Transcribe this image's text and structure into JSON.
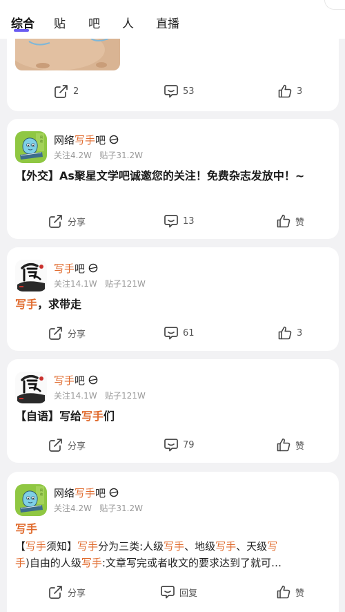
{
  "tabs": [
    "综合",
    "贴",
    "吧",
    "人",
    "直播"
  ],
  "posts": [
    {
      "counts": {
        "edit": "2",
        "comment": "53",
        "like": "3"
      }
    },
    {
      "forum_prefix": "网络",
      "forum_kw": "写手",
      "forum_suffix": "吧",
      "followers": "关注4.2W",
      "posts_count": "贴子31.2W",
      "title": "【外交】As聚星文学吧诚邀您的关注！免费杂志发放中！~",
      "share": "分享",
      "comment": "13",
      "like": "赞"
    },
    {
      "forum_kw": "写手",
      "forum_suffix": "吧",
      "followers": "关注14.1W",
      "posts_count": "贴子121W",
      "title_kw": "写手",
      "title_rest": "，求带走",
      "share": "分享",
      "comment": "61",
      "like": "3"
    },
    {
      "forum_kw": "写手",
      "forum_suffix": "吧",
      "followers": "关注14.1W",
      "posts_count": "贴子121W",
      "title_pre": "【自语】写给",
      "title_kw": "写手",
      "title_post": "们",
      "share": "分享",
      "comment": "79",
      "like": "赞"
    },
    {
      "forum_prefix": "网络",
      "forum_kw": "写手",
      "forum_suffix": "吧",
      "followers": "关注4.2W",
      "posts_count": "贴子31.2W",
      "title_kw": "写手",
      "body": {
        "p1": "【",
        "k1": "写手",
        "p2": "须知】",
        "k2": "写手",
        "p3": "分为三类:人级",
        "k3": "写手",
        "p4": "、地级",
        "k4": "写手",
        "p5": "、天级",
        "k5": "写",
        "k6": "手",
        "p6": ")自由的人级",
        "k7": "写手",
        "p7": ":文章写完或者收文的要求达到了就可…"
      },
      "share": "分享",
      "comment": "回复",
      "like": "赞"
    }
  ],
  "colors": {
    "accent": "#6a5cf2",
    "keyword": "#e06a2c"
  },
  "icons": [
    "edit-icon",
    "share-icon",
    "comment-icon",
    "like-icon",
    "circle-slash-icon"
  ]
}
